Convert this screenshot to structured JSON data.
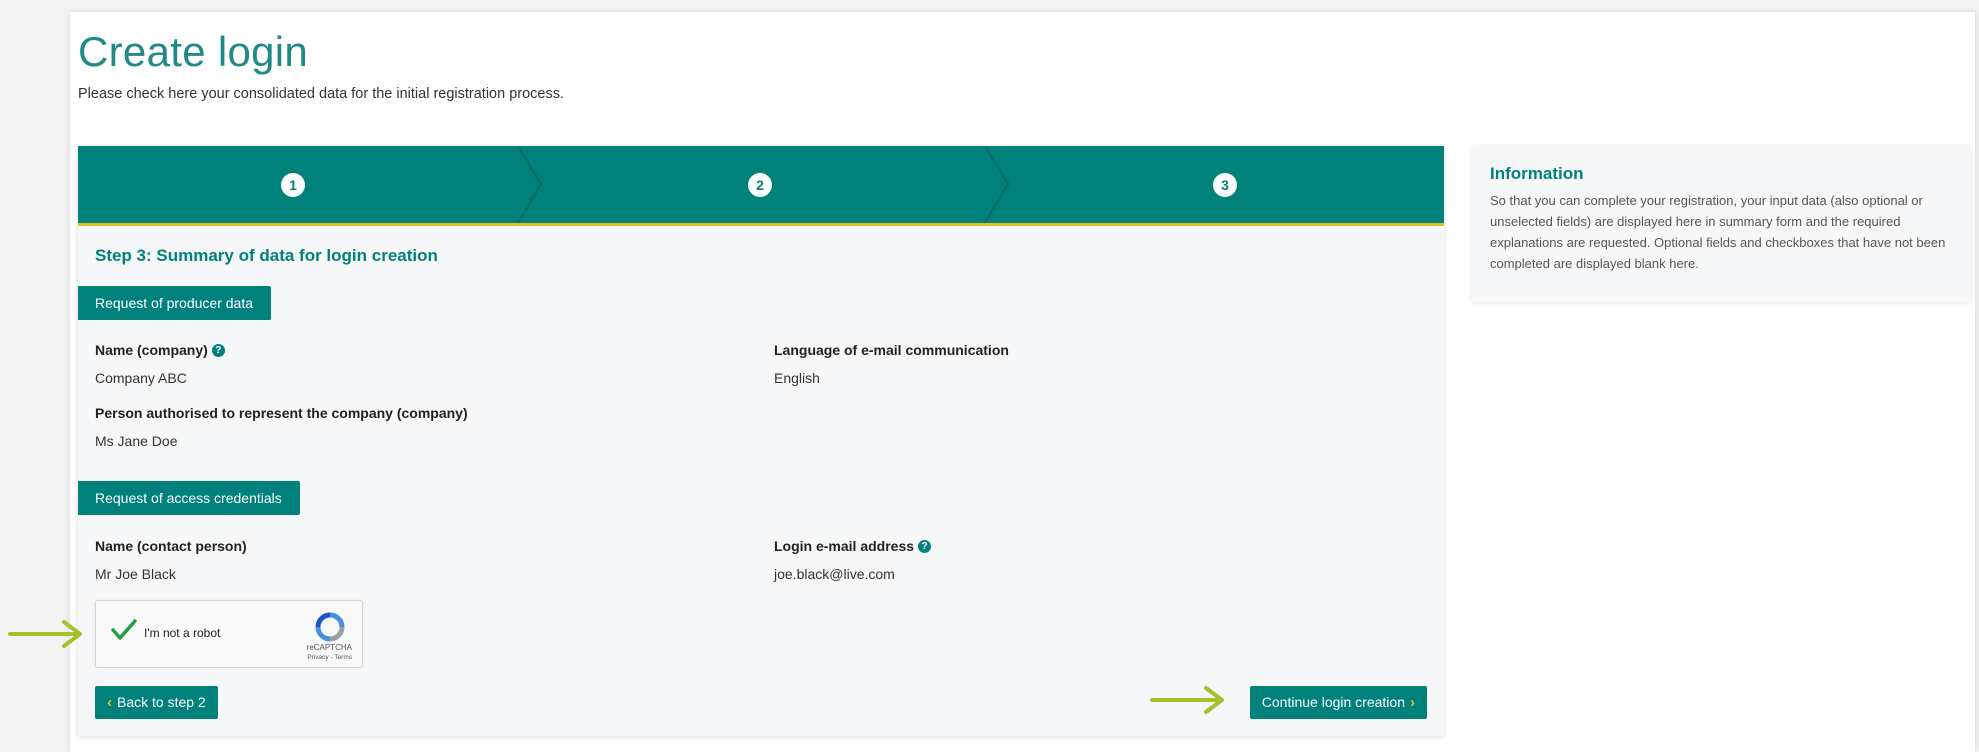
{
  "page": {
    "title": "Create login",
    "subtitle": "Please check here your consolidated data for the initial registration process."
  },
  "stepper": {
    "steps": [
      "1",
      "2",
      "3"
    ],
    "active_step": 3
  },
  "step_title": "Step 3: Summary of data for login creation",
  "producer_section": {
    "header": "Request of producer data",
    "fields": {
      "company_name": {
        "label": "Name (company)",
        "value": "Company ABC"
      },
      "language": {
        "label": "Language of e-mail communication",
        "value": "English"
      },
      "representative": {
        "label": "Person authorised to represent the company (company)",
        "value": "Ms Jane Doe"
      }
    }
  },
  "credentials_section": {
    "header": "Request of access credentials",
    "fields": {
      "contact_name": {
        "label": "Name (contact person)",
        "value": "Mr Joe Black"
      },
      "login_email": {
        "label": "Login e-mail address",
        "value": "joe.black@live.com"
      }
    }
  },
  "recaptcha": {
    "label": "I'm not a robot",
    "brand": "reCAPTCHA",
    "links": "Privacy - Terms",
    "checked": true
  },
  "buttons": {
    "back": "Back to step 2",
    "continue": "Continue login creation"
  },
  "info": {
    "title": "Information",
    "text": "So that you can complete your registration, your input data (also optional or unselected fields) are displayed here in summary form and the required explanations are requested. Optional fields and checkboxes that have not been completed are displayed blank here."
  },
  "colors": {
    "brand_teal": "#00817c",
    "accent_yellow": "#e0c11b",
    "annotation_arrow": "#a4c12a"
  },
  "icons": {
    "help": "question-circle-icon",
    "back": "chevron-left-icon",
    "forward": "chevron-right-icon"
  }
}
